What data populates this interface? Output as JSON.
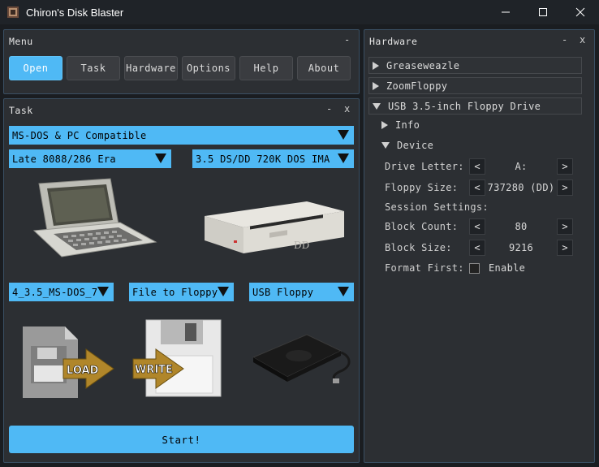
{
  "window": {
    "title": "Chiron's Disk Blaster",
    "controls": {
      "minimize": "minimize",
      "maximize": "maximize",
      "close": "close"
    }
  },
  "menu_panel": {
    "title": "Menu",
    "collapse": "-",
    "buttons": [
      {
        "label": "Open",
        "active": true
      },
      {
        "label": "Task",
        "active": false
      },
      {
        "label": "Hardware",
        "active": false
      },
      {
        "label": "Options",
        "active": false
      },
      {
        "label": "Help",
        "active": false
      },
      {
        "label": "About",
        "active": false
      }
    ]
  },
  "task_panel": {
    "title": "Task",
    "collapse": "-",
    "close": "x",
    "platform": "MS-DOS & PC Compatible",
    "era": "Late 8088/286 Era",
    "format": "3.5  DS/DD 720K DOS IMA",
    "image": "4_3.5_MS-DOS_7",
    "operation": "File to Floppy",
    "device": "USB Floppy",
    "load_label": "LOAD",
    "write_label": "WRITE",
    "start_label": "Start!"
  },
  "hardware_panel": {
    "title": "Hardware",
    "collapse": "-",
    "close": "x",
    "tree": [
      {
        "label": "Greaseweazle",
        "expanded": false
      },
      {
        "label": "ZoomFloppy",
        "expanded": false
      },
      {
        "label": "USB 3.5-inch Floppy Drive",
        "expanded": true
      }
    ],
    "sub_info": "Info",
    "sub_device": "Device",
    "drive_letter_label": "Drive Letter:",
    "drive_letter_value": "A:",
    "floppy_size_label": "Floppy Size:",
    "floppy_size_value": "737280 (DD)",
    "session_label": "Session Settings:",
    "block_count_label": "Block Count:",
    "block_count_value": "80",
    "block_size_label": "Block Size:",
    "block_size_value": "9216",
    "format_first_label": "Format First:",
    "enable_label": "Enable",
    "dec": "<",
    "inc": ">"
  },
  "colors": {
    "accent": "#4fb9f5",
    "panel_bg": "#2c2f33",
    "window_bg": "#1a1d21"
  },
  "icons": [
    "app-icon",
    "laptop-image",
    "floppy-drive-image",
    "load-icon",
    "write-icon",
    "usb-floppy-image"
  ]
}
